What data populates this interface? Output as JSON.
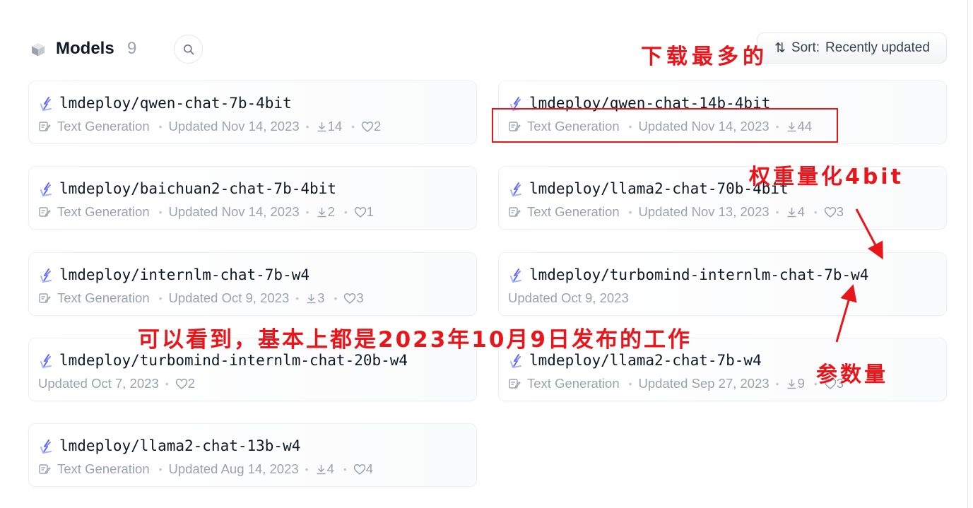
{
  "header": {
    "title": "Models",
    "count": "9",
    "sort_prefix": "Sort:",
    "sort_value": "Recently updated",
    "sort_arrow_icon": "sort-arrows-icon",
    "search_icon": "search-icon"
  },
  "models": [
    {
      "name": "lmdeploy/qwen-chat-7b-4bit",
      "pipeline": "Text Generation",
      "updated": "Updated Nov 14, 2023",
      "downloads": "14",
      "likes": "2"
    },
    {
      "name": "lmdeploy/qwen-chat-14b-4bit",
      "pipeline": "Text Generation",
      "updated": "Updated Nov 14, 2023",
      "downloads": "44",
      "likes": null
    },
    {
      "name": "lmdeploy/baichuan2-chat-7b-4bit",
      "pipeline": "Text Generation",
      "updated": "Updated Nov 14, 2023",
      "downloads": "2",
      "likes": "1"
    },
    {
      "name": "lmdeploy/llama2-chat-70b-4bit",
      "pipeline": "Text Generation",
      "updated": "Updated Nov 13, 2023",
      "downloads": "4",
      "likes": "3"
    },
    {
      "name": "lmdeploy/internlm-chat-7b-w4",
      "pipeline": "Text Generation",
      "updated": "Updated Oct 9, 2023",
      "downloads": "3",
      "likes": "3"
    },
    {
      "name": "lmdeploy/turbomind-internlm-chat-7b-w4",
      "pipeline": null,
      "updated": "Updated Oct 9, 2023",
      "downloads": null,
      "likes": null
    },
    {
      "name": "lmdeploy/turbomind-internlm-chat-20b-w4",
      "pipeline": null,
      "updated": "Updated Oct 7, 2023",
      "downloads": null,
      "likes": "2"
    },
    {
      "name": "lmdeploy/llama2-chat-7b-w4",
      "pipeline": "Text Generation",
      "updated": "Updated Sep 27, 2023",
      "downloads": "9",
      "likes": "3"
    },
    {
      "name": "lmdeploy/llama2-chat-13b-w4",
      "pipeline": "Text Generation",
      "updated": "Updated Aug 14, 2023",
      "downloads": "4",
      "likes": "4"
    }
  ],
  "annotations": {
    "most_downloaded": "下载最多的",
    "weight_quant": "权重量化4bit",
    "release_note": "可以看到，基本上都是2023年10月9日发布的工作",
    "param_count": "参数量",
    "color": "#e8151b"
  },
  "colors": {
    "accent_red": "#e8151b",
    "meta_gray": "#9ca3af",
    "text_dark": "#111827",
    "icon_blue": "#6366f1"
  }
}
